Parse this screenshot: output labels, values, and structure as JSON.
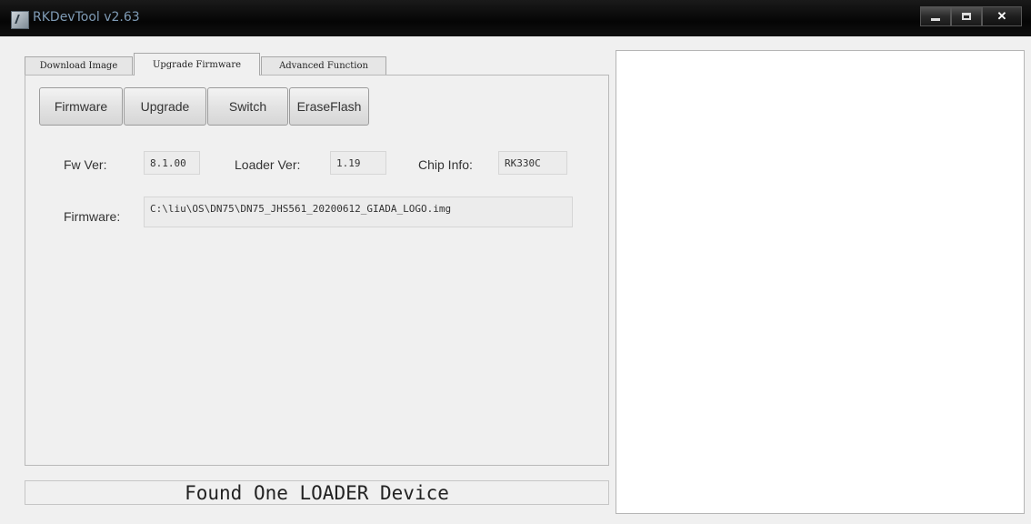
{
  "window": {
    "title": "RKDevTool v2.63"
  },
  "tabs": [
    {
      "label": "Download Image"
    },
    {
      "label": "Upgrade Firmware"
    },
    {
      "label": "Advanced Function"
    }
  ],
  "toolbar": {
    "firmware_label": "Firmware",
    "upgrade_label": "Upgrade",
    "switch_label": "Switch",
    "erase_label": "EraseFlash"
  },
  "info": {
    "fw_ver_label": "Fw Ver:",
    "fw_ver_value": "8.1.00",
    "loader_ver_label": "Loader Ver:",
    "loader_ver_value": "1.19",
    "chip_info_label": "Chip Info:",
    "chip_info_value": "RK330C",
    "firmware_label": "Firmware:",
    "firmware_path": "C:\\liu\\OS\\DN75\\DN75_JHS561_20200612_GIADA_LOGO.img"
  },
  "status": {
    "text": "Found One LOADER Device"
  },
  "colors": {
    "titlebar": "#0a0a0a",
    "title_text": "#7f9bb5",
    "window_bg": "#f0f0f0",
    "log_bg": "#ffffff"
  }
}
